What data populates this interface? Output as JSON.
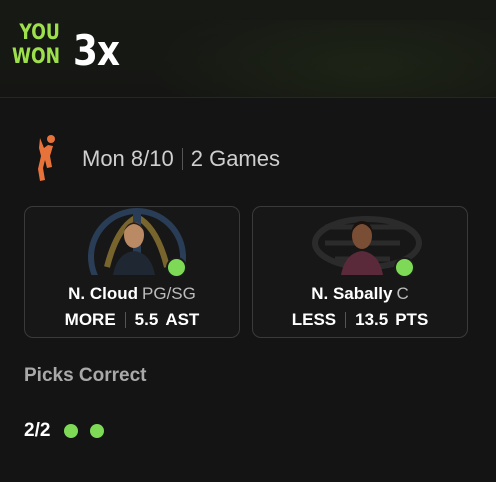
{
  "header": {
    "line1": "YOU",
    "line2": "WON",
    "multiplier": "3x"
  },
  "slate": {
    "league_icon": "wnba-logo-icon",
    "date": "Mon 8/10",
    "games": "2 Games"
  },
  "picks": [
    {
      "player": "N. Cloud",
      "position": "PG/SG",
      "direction": "MORE",
      "line": "5.5",
      "stat": "AST",
      "result_icon": "correct-dot-icon"
    },
    {
      "player": "N. Sabally",
      "position": "C",
      "direction": "LESS",
      "line": "13.5",
      "stat": "PTS",
      "result_icon": "correct-dot-icon"
    }
  ],
  "summary": {
    "title": "Picks Correct",
    "count": "2/2",
    "correct_dots": 2
  },
  "colors": {
    "accent_green": "#9ee04c",
    "dot_green": "#7ed957",
    "background": "#141414",
    "card_border": "#3a3a3a"
  }
}
